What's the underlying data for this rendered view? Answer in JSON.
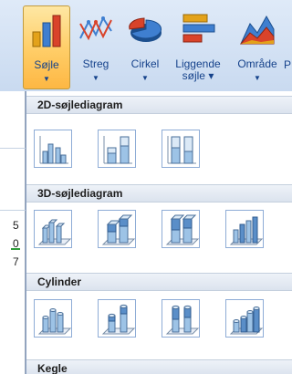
{
  "ribbon": {
    "buttons": [
      {
        "id": "column",
        "icon": "column-chart-icon",
        "line1": "Søjle",
        "line2": "",
        "active": true
      },
      {
        "id": "line",
        "icon": "line-chart-icon",
        "line1": "Streg",
        "line2": "",
        "active": false
      },
      {
        "id": "pie",
        "icon": "pie-chart-icon",
        "line1": "Cirkel",
        "line2": "",
        "active": false
      },
      {
        "id": "bar",
        "icon": "bar-chart-icon",
        "line1": "Liggende",
        "line2": "søjle",
        "active": false
      },
      {
        "id": "area",
        "icon": "area-chart-icon",
        "line1": "Område",
        "line2": "",
        "active": false
      }
    ],
    "overflow_label": "P"
  },
  "sheet": {
    "row_fragments": [
      "5",
      "0",
      "7"
    ]
  },
  "gallery": {
    "sections": [
      {
        "title": "2D-søjlediagram",
        "items": [
          "clustered-column-2d-icon",
          "stacked-column-2d-icon",
          "stacked-100-column-2d-icon"
        ]
      },
      {
        "title": "3D-søjlediagram",
        "items": [
          "clustered-column-3d-icon",
          "stacked-column-3d-icon",
          "stacked-100-column-3d-icon",
          "column-3d-icon"
        ]
      },
      {
        "title": "Cylinder",
        "items": [
          "clustered-cylinder-icon",
          "stacked-cylinder-icon",
          "stacked-100-cylinder-icon",
          "cylinder-3d-icon"
        ]
      },
      {
        "title": "Kegle",
        "items": []
      }
    ]
  },
  "colors": {
    "accent": "#15428b",
    "active_button": "#ffcf6a",
    "thumb_border": "#8eacd6",
    "thumb_fill": "#9dc3e6"
  }
}
